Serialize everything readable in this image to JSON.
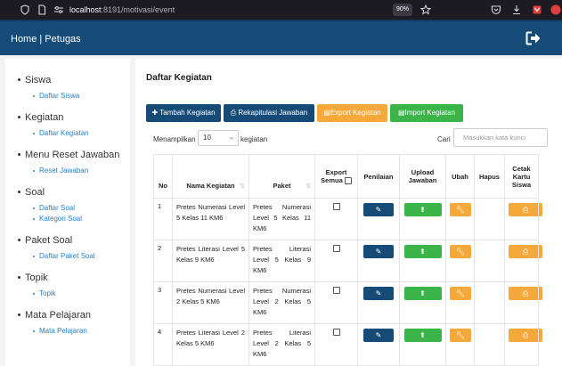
{
  "browser": {
    "host": "localhost",
    "path": ":8191/motivasi/event",
    "zoom": "90%"
  },
  "navbar": {
    "title": "Home | Petugas"
  },
  "sidebar": {
    "groups": [
      {
        "label": "Siswa",
        "items": [
          "Daftar Siswa"
        ]
      },
      {
        "label": "Kegiatan",
        "items": [
          "Daftar Kegiatan"
        ]
      },
      {
        "label": "Menu Reset Jawaban",
        "items": [
          "Reset Jawaban"
        ]
      },
      {
        "label": "Soal",
        "items": [
          "Daftar Soal",
          "Kategori Soal"
        ]
      },
      {
        "label": "Paket Soal",
        "items": [
          "Daftar Paket Soal"
        ]
      },
      {
        "label": "Topik",
        "items": [
          "Topik"
        ]
      },
      {
        "label": "Mata Pelajaran",
        "items": [
          "Mata Pelajaran"
        ]
      }
    ]
  },
  "main": {
    "title": "Daftar Kegiatan",
    "buttons": {
      "add": "Tambah Kegiatan",
      "recap": "Rekapitulasi Jawaban",
      "export": "Export Kegiatan",
      "import": "Import Kegiatan"
    },
    "length": {
      "label": "Menampilkan",
      "value": "10",
      "suffix": "kegiatan"
    },
    "search": {
      "label": "Cari",
      "placeholder": "Masukkan kata kunci"
    },
    "table": {
      "headers": {
        "no": "No",
        "name": "Nama Kegiatan",
        "paket": "Paket",
        "export_all": "Export Semua",
        "penilaian": "Penilaian",
        "upload": "Upload Jawaban",
        "ubah": "Ubah",
        "hapus": "Hapus",
        "cetak": "Cetak Kartu Siswa"
      },
      "rows": [
        {
          "no": "1",
          "name": "Pretes Numerasi Level 5 Kelas 11 KM6",
          "paket": "Pretes Numerasi Level 5 Kelas 11 KM6"
        },
        {
          "no": "2",
          "name": "Pretes Literasi Level 5 Kelas 9 KM6",
          "paket": "Pretes Literasi Level 5 Kelas 9 KM6"
        },
        {
          "no": "3",
          "name": "Pretes Numerasi Level 2 Kelas 5 KM6",
          "paket": "Pretes Numerasi Level 2 Kelas 5 KM6"
        },
        {
          "no": "4",
          "name": "Pretes Literasi Level 2 Kelas 5 KM6",
          "paket": "Pretes Literasi Level 2 Kelas 5 KM6"
        }
      ]
    }
  },
  "colors": {
    "primary": "#164b78",
    "orange": "#f6a93b",
    "green": "#3bb54a",
    "link": "#2a7fc1"
  }
}
